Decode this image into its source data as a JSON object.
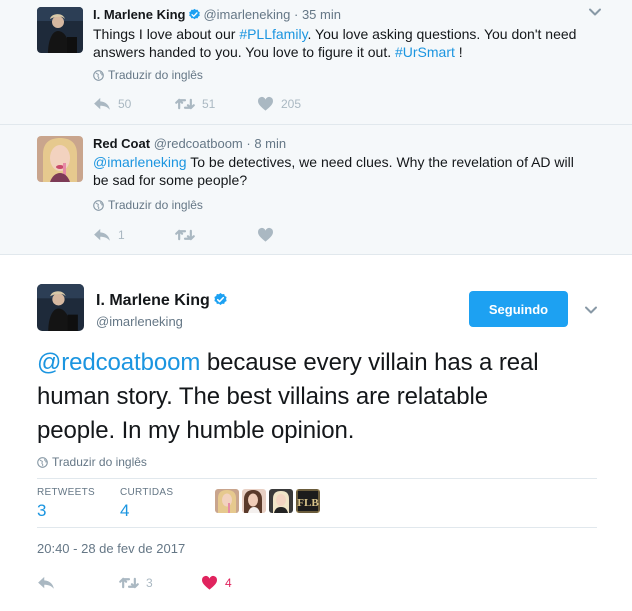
{
  "tweet1": {
    "name": "I. Marlene King",
    "handle": "@imarleneking",
    "time": "· 35 min",
    "text_line1_plain": "Things I love about our ",
    "text_line1_hashtag": "#PLLfamily",
    "text_line1_rest": ".  You love asking questions. You don't need",
    "text_line2_plain": "answers handed to you. You love to figure it out. ",
    "text_line2_hashtag": "#UrSmart",
    "text_line2_rest": " !",
    "translate": "Traduzir do inglês",
    "replies": "50",
    "retweets": "51",
    "likes": "205"
  },
  "tweet2": {
    "name": "Red Coat",
    "handle": "@redcoatboom",
    "time": "· 8 min",
    "mention": "@imarleneking",
    "text_rest": " To be detectives, we need clues. Why the revelation of AD will",
    "text_line2": "be sad for some people?",
    "translate": "Traduzir do inglês",
    "replies": "1"
  },
  "main": {
    "name": "I. Marlene King",
    "handle": "@imarleneking",
    "follow_label": "Seguindo",
    "mention": "@redcoatboom",
    "text_line1_rest": " because every villain has a real",
    "text_line2": "human story. The best villains are relatable",
    "text_line3": "people. In my humble opinion.",
    "translate": "Traduzir do inglês",
    "retweets_label": "RETWEETS",
    "retweets_value": "3",
    "likes_label": "CURTIDAS",
    "likes_value": "4",
    "liker_badge": "FLB",
    "timestamp": "20:40 - 28 de fev de 2017",
    "action_retweets": "3",
    "action_likes": "4"
  },
  "colors": {
    "link": "#1b95e0",
    "follow_button": "#1da1f2",
    "heart_active": "#e0245e",
    "muted": "#657786",
    "icon": "#aab8c2"
  },
  "icons": [
    "verified-badge-icon",
    "globe-icon",
    "reply-icon",
    "retweet-icon",
    "heart-icon",
    "chevron-down-icon"
  ]
}
